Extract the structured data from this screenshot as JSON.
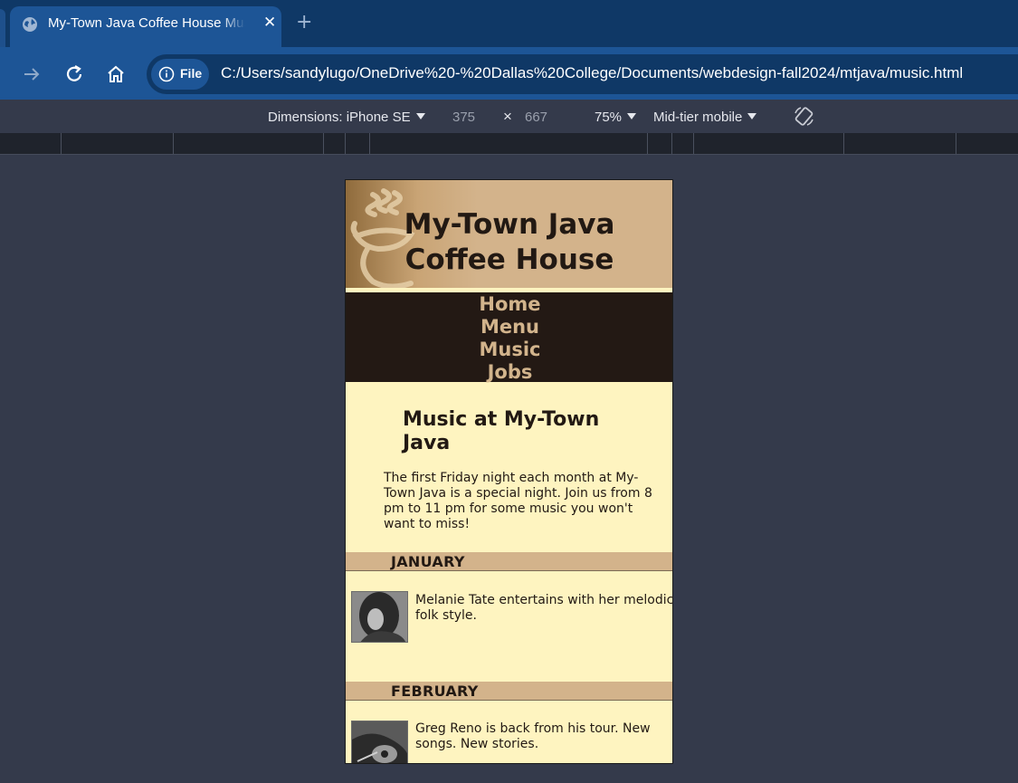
{
  "browser": {
    "tab_title": "My-Town Java Coffee House Music",
    "new_tab_label": "+",
    "close_label": "✕",
    "file_chip_label": "File",
    "url": "C:/Users/sandylugo/OneDrive%20-%20Dallas%20College/Documents/webdesign-fall2024/mtjava/music.html"
  },
  "devtools": {
    "device_label": "Dimensions: iPhone SE",
    "width": "375",
    "times": "×",
    "height": "667",
    "zoom": "75%",
    "throttle": "Mid-tier mobile"
  },
  "site": {
    "title": "My-Town Java Coffee House",
    "nav": [
      "Home",
      "Menu",
      "Music",
      "Jobs"
    ],
    "heading": "Music at My-Town Java",
    "intro": "The first Friday night each month at My-Town Java is a special night. Join us from 8 pm to 11 pm for some music you won't want to miss!",
    "months": [
      {
        "name": "JANUARY",
        "text": "Melanie Tate entertains with her melodic folk style."
      },
      {
        "name": "FEBRUARY",
        "text": "Greg Reno is back from his tour. New songs. New stories."
      }
    ]
  }
}
